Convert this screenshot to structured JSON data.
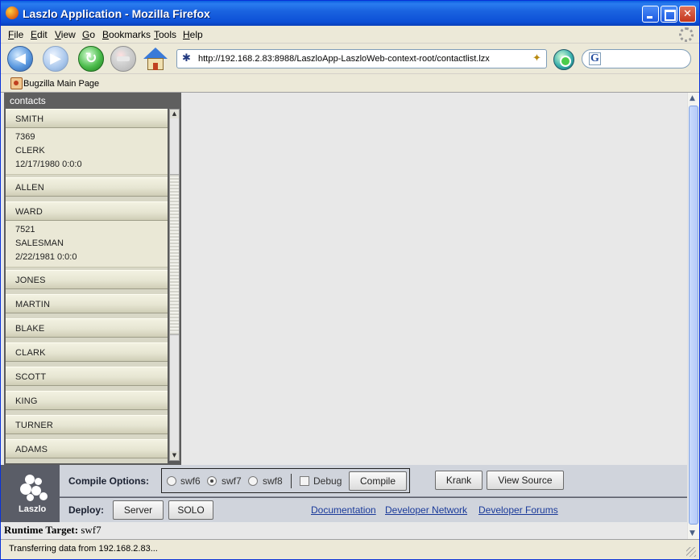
{
  "window": {
    "title": "Laszlo Application - Mozilla Firefox"
  },
  "menu": [
    "File",
    "Edit",
    "View",
    "Go",
    "Bookmarks",
    "Tools",
    "Help"
  ],
  "nav": {
    "url": "http://192.168.2.83:8988/LaszloApp-LaszloWeb-context-root/contactlist.lzx",
    "search_engine": "G"
  },
  "bookmarks": [
    {
      "label": "Bugzilla Main Page"
    }
  ],
  "contacts": {
    "title": "contacts",
    "items": [
      {
        "name": "SMITH",
        "id": "7369",
        "job": "CLERK",
        "date": "12/17/1980 0:0:0",
        "expanded": true
      },
      {
        "name": "ALLEN",
        "expanded": false
      },
      {
        "name": "WARD",
        "id": "7521",
        "job": "SALESMAN",
        "date": "2/22/1981 0:0:0",
        "expanded": true
      },
      {
        "name": "JONES",
        "expanded": false
      },
      {
        "name": "MARTIN",
        "expanded": false
      },
      {
        "name": "BLAKE",
        "expanded": false
      },
      {
        "name": "CLARK",
        "expanded": false
      },
      {
        "name": "SCOTT",
        "expanded": false
      },
      {
        "name": "KING",
        "expanded": false
      },
      {
        "name": "TURNER",
        "expanded": false
      },
      {
        "name": "ADAMS",
        "expanded": false
      }
    ]
  },
  "devbar": {
    "logo_text": "Laszlo",
    "compile_options_label": "Compile Options:",
    "options": [
      {
        "label": "swf6",
        "checked": false
      },
      {
        "label": "swf7",
        "checked": true
      },
      {
        "label": "swf8",
        "checked": false
      }
    ],
    "debug_label": "Debug",
    "debug_checked": false,
    "compile_button": "Compile",
    "krank_button": "Krank",
    "view_source_button": "View Source",
    "deploy_label": "Deploy:",
    "server_button": "Server",
    "solo_button": "SOLO",
    "links": [
      "Documentation",
      "Developer Network",
      "Developer Forums"
    ]
  },
  "runtime": {
    "label": "Runtime Target:",
    "value": "swf7"
  },
  "status": {
    "text": "Transferring data from 192.168.2.83..."
  }
}
